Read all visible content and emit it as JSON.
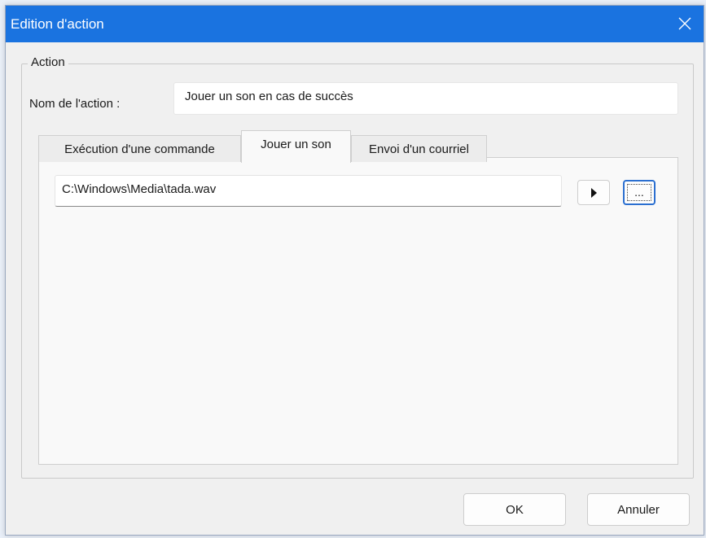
{
  "window": {
    "title": "Edition d'action"
  },
  "action_group": {
    "legend": "Action",
    "name_label": "Nom de l'action :",
    "name_value": "Jouer un son en cas de succès"
  },
  "tabs": [
    {
      "label": "Exécution d'une commande",
      "active": false
    },
    {
      "label": "Jouer un son",
      "active": true
    },
    {
      "label": "Envoi d'un courriel",
      "active": false
    }
  ],
  "sound_tab": {
    "path_value": "C:\\Windows\\Media\\tada.wav",
    "play_icon": "play-icon",
    "browse_label": "..."
  },
  "buttons": {
    "ok": "OK",
    "cancel": "Annuler"
  },
  "colors": {
    "titlebar": "#1a73e0",
    "focus_border": "#2b6fd0"
  }
}
